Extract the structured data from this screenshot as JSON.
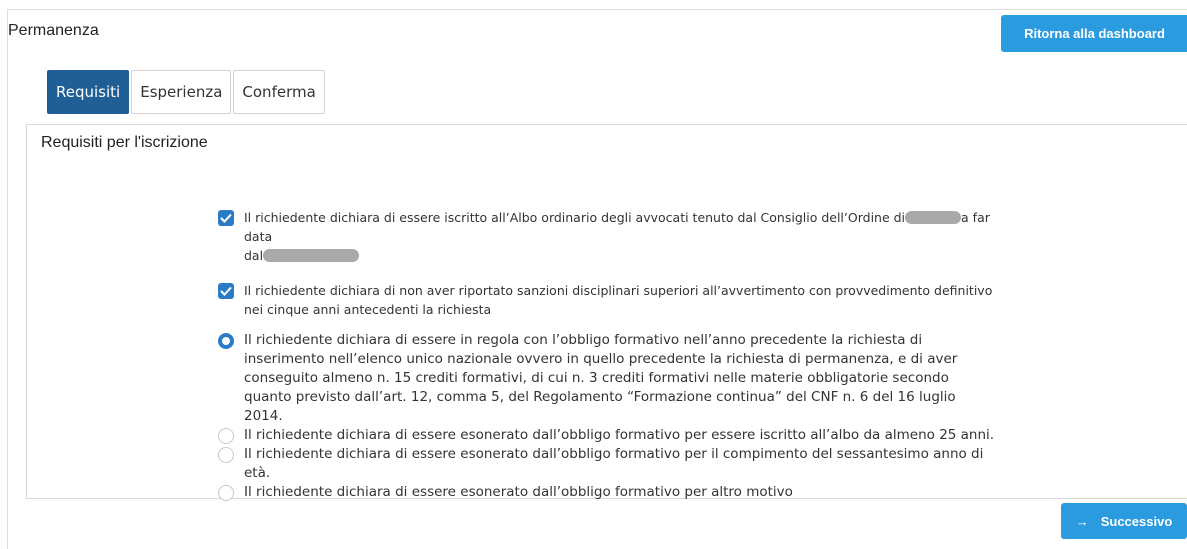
{
  "header": {
    "title": "Permanenza",
    "dashboard_button": "Ritorna alla dashboard"
  },
  "tabs": [
    {
      "label": "Requisiti",
      "active": true
    },
    {
      "label": "Esperienza",
      "active": false
    },
    {
      "label": "Conferma",
      "active": false
    }
  ],
  "panel": {
    "title": "Requisiti per l'iscrizione"
  },
  "checks": [
    {
      "text_before": "Il richiedente dichiara di essere iscritto all’Albo ordinario degli avvocati tenuto dal Consiglio dell’Ordine di",
      "text_middle": "a far data",
      "text_after": "dal",
      "checked": true
    },
    {
      "text": "Il richiedente dichiara di non aver riportato sanzioni disciplinari superiori all’avvertimento con provvedimento definitivo nei cinque anni antecedenti la richiesta",
      "checked": true
    }
  ],
  "radios": [
    {
      "text": "Il richiedente dichiara di essere in regola con l’obbligo formativo nell’anno precedente la richiesta di inserimento nell’elenco unico nazionale ovvero in quello precedente la richiesta di permanenza, e di aver conseguito almeno n. 15 crediti formativi, di cui n. 3 crediti formativi nelle materie obbligatorie secondo quanto previsto dall’art. 12, comma 5, del Regolamento “Formazione continua” del CNF n. 6 del 16 luglio 2014.",
      "selected": true
    },
    {
      "text": "Il richiedente dichiara di essere esonerato dall’obbligo formativo per essere iscritto all’albo da almeno 25 anni.",
      "selected": false
    },
    {
      "text": "Il richiedente dichiara di essere esonerato dall’obbligo formativo per il compimento del sessantesimo anno di età.",
      "selected": false
    },
    {
      "text": "Il richiedente dichiara di essere esonerato dall’obbligo formativo per altro motivo",
      "selected": false
    }
  ],
  "footer": {
    "next_button": "Successivo",
    "next_icon": "arrow-right-icon"
  },
  "colors": {
    "primary": "#2b9be0",
    "tab_active": "#1f5f96",
    "control": "#2b7cc5"
  }
}
